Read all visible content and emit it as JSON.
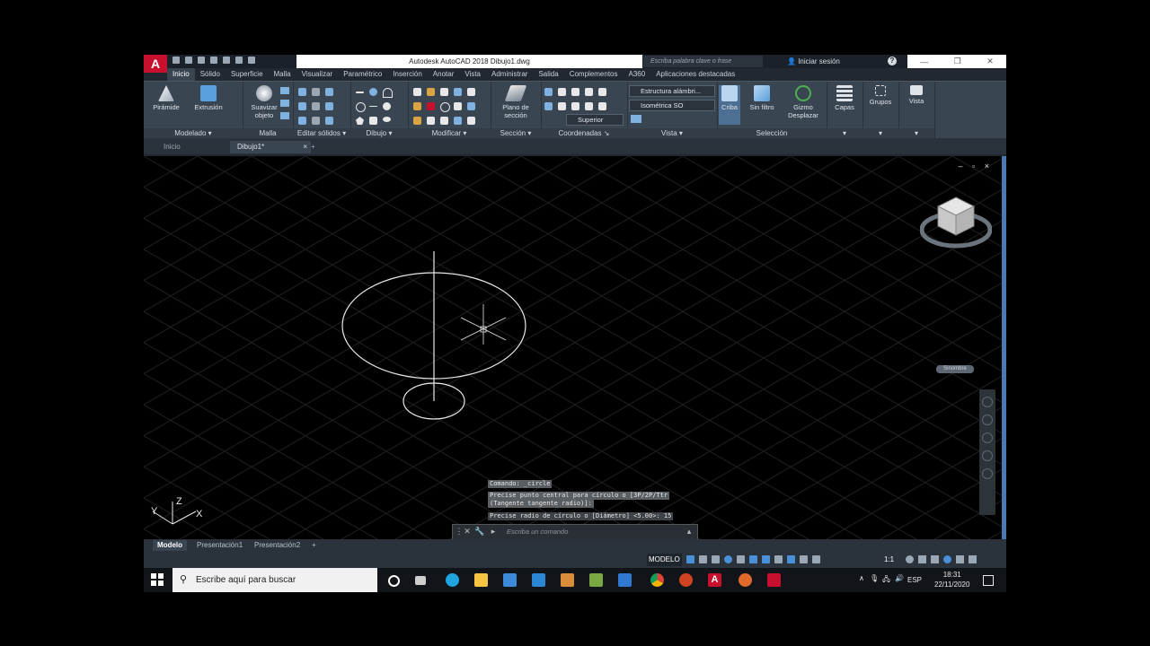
{
  "titlebar": {
    "app_letter": "A",
    "title": "Autodesk AutoCAD 2018   Dibujo1.dwg",
    "search_placeholder": "Escriba palabra clave o frase",
    "signin": "Iniciar sesión",
    "help": "?"
  },
  "ribbon_tabs": [
    "Inicio",
    "Sólido",
    "Superficie",
    "Malla",
    "Visualizar",
    "Paramétrico",
    "Inserción",
    "Anotar",
    "Vista",
    "Administrar",
    "Salida",
    "Complementos",
    "A360",
    "Aplicaciones destacadas"
  ],
  "ribbon": {
    "piramide": "Pirámide",
    "extrusion": "Extrusión",
    "suavizar": "Suavizar objeto",
    "plano": "Plano de sección",
    "criba": "Criba",
    "sin_filtro": "Sin filtro",
    "gizmo": "Gizmo Desplazar",
    "capas": "Capas",
    "grupos": "Grupos",
    "vista": "Vista",
    "visual_style": "Estructura alámbri...",
    "view_dropdown": "Isométrica SO",
    "ucs_dropdown": "Superior",
    "panels": {
      "modelado": "Modelado",
      "malla": "Malla",
      "editar_solidos": "Editar sólidos",
      "dibujo": "Dibujo",
      "modificar": "Modificar",
      "seccion": "Sección",
      "coordenadas": "Coordenadas",
      "vista": "Vista",
      "seleccion": "Selección"
    }
  },
  "doc_tabs": {
    "home": "Inicio",
    "drawing": "Dibujo1*",
    "close": "×",
    "add": "+"
  },
  "viewport": {
    "controls": "– ▫ ×",
    "wcs": "Sinombre",
    "ucs_labels": {
      "x": "X",
      "y": "Y",
      "z": "Z"
    }
  },
  "command": {
    "history": [
      "Comando: _circle",
      "Precise punto central para círculo o [3P/2P/Ttr",
      "(Tangente tangente radio)]:",
      "Precise radio de círculo o [Diámetro] <5.00>: 15"
    ],
    "placeholder": "Escriba un comando"
  },
  "layout_tabs": [
    "Modelo",
    "Presentación1",
    "Presentación2"
  ],
  "statusbar": {
    "model": "MODELO",
    "scale": "1:1"
  },
  "taskbar": {
    "search": "Escribe aquí para buscar",
    "lang": "ESP",
    "time": "18:31",
    "date": "22/11/2020"
  }
}
